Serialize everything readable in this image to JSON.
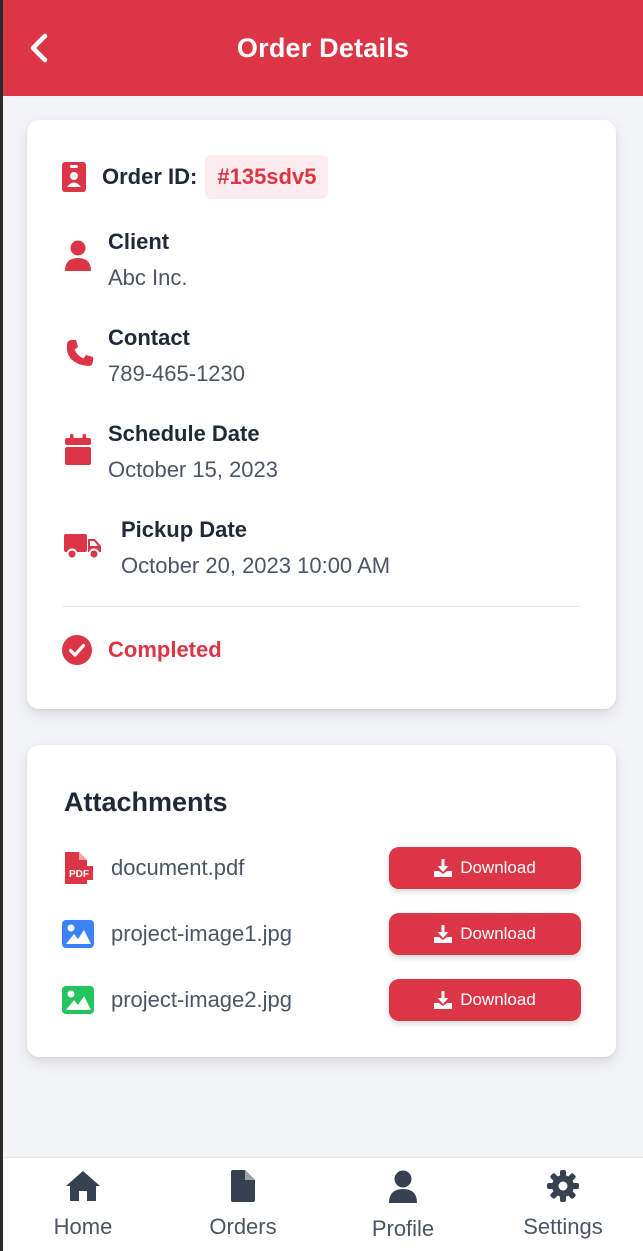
{
  "header": {
    "title": "Order Details",
    "back_icon": "chevron-left-icon",
    "background": "#dc3545"
  },
  "order": {
    "id_label": "Order ID:",
    "id_value": "#135sdv5",
    "client_label": "Client",
    "client_value": "Abc Inc.",
    "contact_label": "Contact",
    "contact_value": "789-465-1230",
    "schedule_label": "Schedule Date",
    "schedule_value": "October 15, 2023",
    "pickup_label": "Pickup Date",
    "pickup_value": "October 20, 2023 10:00 AM",
    "status": "Completed"
  },
  "attachments": {
    "title": "Attachments",
    "items": [
      {
        "name": "document.pdf",
        "icon": "pdf-file-icon",
        "button": "Download",
        "icon_color": "#dc3545"
      },
      {
        "name": "project-image1.jpg",
        "icon": "image-icon",
        "button": "Download",
        "icon_color": "#3b82f6"
      },
      {
        "name": "project-image2.jpg",
        "icon": "image-icon",
        "button": "Download",
        "icon_color": "#22c55e"
      }
    ]
  },
  "nav": {
    "items": [
      {
        "label": "Home",
        "icon": "home-icon"
      },
      {
        "label": "Orders",
        "icon": "file-icon"
      },
      {
        "label": "Profile",
        "icon": "user-icon"
      },
      {
        "label": "Settings",
        "icon": "gear-icon"
      }
    ]
  },
  "colors": {
    "accent": "#dc3545",
    "text": "#1f2937",
    "muted": "#4b5563",
    "nav_icon": "#374151"
  }
}
